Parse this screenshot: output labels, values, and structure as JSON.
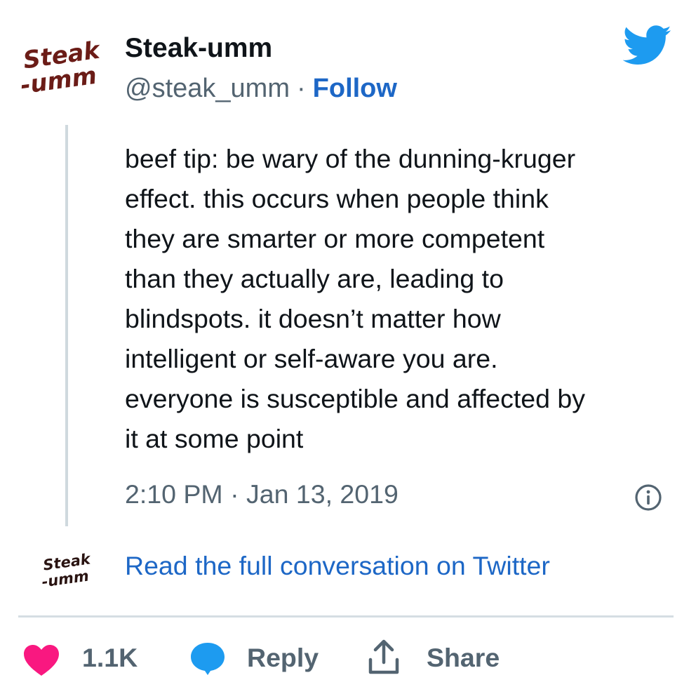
{
  "author": {
    "display_name": "Steak-umm",
    "handle": "@steak_umm",
    "separator": "·",
    "follow_label": "Follow",
    "avatar_icon": "steak-umm-logo",
    "logo_line1": "Steak",
    "logo_line2": "-umm",
    "logo_color": "#6b1c17"
  },
  "platform_icon": "twitter-bird-icon",
  "colors": {
    "twitter_blue": "#1d9bf0",
    "link_blue": "#1d67c6",
    "like_pink": "#f91880",
    "secondary_text": "#536471",
    "thread_line": "#cfd9de"
  },
  "tweet": {
    "lines": [
      "beef tip: be wary of the dunning-kruger",
      "effect. this occurs when people think",
      "they are smarter or more competent",
      "than they actually are, leading to",
      "blindspots. it doesn’t matter how",
      "intelligent or self-aware you are.",
      "everyone is susceptible and affected by",
      "it at some point"
    ],
    "timestamp": "2:10 PM · Jan 13, 2019"
  },
  "conversation_link": "Read the full conversation on Twitter",
  "actions": {
    "like_count": "1.1K",
    "reply_label": "Reply",
    "share_label": "Share"
  }
}
